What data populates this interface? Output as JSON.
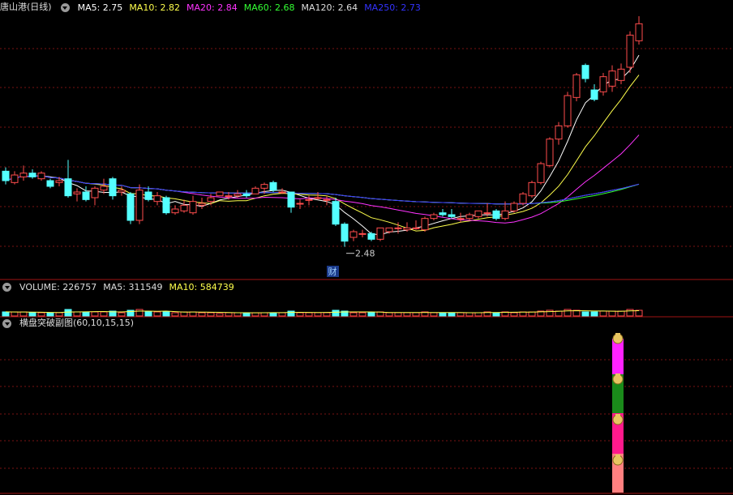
{
  "header": {
    "title": "唐山港(日线)",
    "ma": [
      {
        "label": "MA5: 2.75",
        "color": "#ffffff"
      },
      {
        "label": "MA10: 2.82",
        "color": "#ffff4c"
      },
      {
        "label": "MA20: 2.84",
        "color": "#ff33ff"
      },
      {
        "label": "MA60: 2.68",
        "color": "#33ff33"
      },
      {
        "label": "MA120: 2.64",
        "color": "#dddddd"
      },
      {
        "label": "MA250: 2.73",
        "color": "#3333ff"
      }
    ]
  },
  "volume_header": {
    "items": [
      {
        "label": "VOLUME: 226757",
        "color": "#dddddd"
      },
      {
        "label": "MA5: 311549",
        "color": "#dddddd"
      },
      {
        "label": "MA10: 584739",
        "color": "#ffff4c"
      }
    ]
  },
  "indicator_header": {
    "label": "横盘突破副图(60,10,15,15)",
    "color": "#dddddd"
  },
  "annotations": {
    "low_label": "2.48",
    "fin_marker": "财"
  },
  "colors": {
    "up": "#ff4d4d",
    "down": "#54ffff",
    "grid": "#7a1212",
    "sep": "#a01414"
  },
  "chart_data": {
    "type": "candlestick",
    "ylim": [
      2.35,
      3.7
    ],
    "candles": [
      {
        "o": 2.88,
        "c": 2.83,
        "h": 2.9,
        "l": 2.81
      },
      {
        "o": 2.82,
        "c": 2.86,
        "h": 2.88,
        "l": 2.81
      },
      {
        "o": 2.85,
        "c": 2.87,
        "h": 2.91,
        "l": 2.83
      },
      {
        "o": 2.87,
        "c": 2.85,
        "h": 2.89,
        "l": 2.84
      },
      {
        "o": 2.84,
        "c": 2.87,
        "h": 2.88,
        "l": 2.83
      },
      {
        "o": 2.83,
        "c": 2.8,
        "h": 2.84,
        "l": 2.79
      },
      {
        "o": 2.82,
        "c": 2.83,
        "h": 2.85,
        "l": 2.8
      },
      {
        "o": 2.84,
        "c": 2.75,
        "h": 2.94,
        "l": 2.74
      },
      {
        "o": 2.76,
        "c": 2.77,
        "h": 2.79,
        "l": 2.72
      },
      {
        "o": 2.77,
        "c": 2.73,
        "h": 2.8,
        "l": 2.72
      },
      {
        "o": 2.74,
        "c": 2.79,
        "h": 2.8,
        "l": 2.7
      },
      {
        "o": 2.78,
        "c": 2.8,
        "h": 2.84,
        "l": 2.76
      },
      {
        "o": 2.84,
        "c": 2.75,
        "h": 2.85,
        "l": 2.73
      },
      {
        "o": 2.77,
        "c": 2.78,
        "h": 2.8,
        "l": 2.75
      },
      {
        "o": 2.76,
        "c": 2.62,
        "h": 2.77,
        "l": 2.6
      },
      {
        "o": 2.62,
        "c": 2.78,
        "h": 2.81,
        "l": 2.6
      },
      {
        "o": 2.77,
        "c": 2.73,
        "h": 2.8,
        "l": 2.72
      },
      {
        "o": 2.72,
        "c": 2.75,
        "h": 2.77,
        "l": 2.7
      },
      {
        "o": 2.74,
        "c": 2.66,
        "h": 2.75,
        "l": 2.65
      },
      {
        "o": 2.66,
        "c": 2.68,
        "h": 2.7,
        "l": 2.65
      },
      {
        "o": 2.67,
        "c": 2.7,
        "h": 2.73,
        "l": 2.66
      },
      {
        "o": 2.66,
        "c": 2.72,
        "h": 2.75,
        "l": 2.65
      },
      {
        "o": 2.7,
        "c": 2.71,
        "h": 2.74,
        "l": 2.68
      },
      {
        "o": 2.72,
        "c": 2.74,
        "h": 2.76,
        "l": 2.7
      },
      {
        "o": 2.75,
        "c": 2.77,
        "h": 2.77,
        "l": 2.75
      },
      {
        "o": 2.75,
        "c": 2.75,
        "h": 2.77,
        "l": 2.73
      },
      {
        "o": 2.75,
        "c": 2.76,
        "h": 2.78,
        "l": 2.74
      },
      {
        "o": 2.76,
        "c": 2.75,
        "h": 2.78,
        "l": 2.74
      },
      {
        "o": 2.76,
        "c": 2.79,
        "h": 2.8,
        "l": 2.76
      },
      {
        "o": 2.79,
        "c": 2.81,
        "h": 2.82,
        "l": 2.76
      },
      {
        "o": 2.82,
        "c": 2.78,
        "h": 2.83,
        "l": 2.77
      },
      {
        "o": 2.77,
        "c": 2.77,
        "h": 2.79,
        "l": 2.76
      },
      {
        "o": 2.77,
        "c": 2.69,
        "h": 2.77,
        "l": 2.66
      },
      {
        "o": 2.71,
        "c": 2.71,
        "h": 2.73,
        "l": 2.68
      },
      {
        "o": 2.73,
        "c": 2.73,
        "h": 2.75,
        "l": 2.7
      },
      {
        "o": 2.74,
        "c": 2.74,
        "h": 2.77,
        "l": 2.73
      },
      {
        "o": 2.73,
        "c": 2.73,
        "h": 2.75,
        "l": 2.7
      },
      {
        "o": 2.72,
        "c": 2.6,
        "h": 2.74,
        "l": 2.59
      },
      {
        "o": 2.6,
        "c": 2.51,
        "h": 2.61,
        "l": 2.48
      },
      {
        "o": 2.53,
        "c": 2.56,
        "h": 2.57,
        "l": 2.51
      },
      {
        "o": 2.55,
        "c": 2.55,
        "h": 2.57,
        "l": 2.53
      },
      {
        "o": 2.55,
        "c": 2.52,
        "h": 2.56,
        "l": 2.51
      },
      {
        "o": 2.52,
        "c": 2.58,
        "h": 2.58,
        "l": 2.51
      },
      {
        "o": 2.56,
        "c": 2.58,
        "h": 2.58,
        "l": 2.55
      },
      {
        "o": 2.58,
        "c": 2.58,
        "h": 2.61,
        "l": 2.55
      },
      {
        "o": 2.57,
        "c": 2.58,
        "h": 2.61,
        "l": 2.56
      },
      {
        "o": 2.58,
        "c": 2.58,
        "h": 2.62,
        "l": 2.57
      },
      {
        "o": 2.57,
        "c": 2.63,
        "h": 2.64,
        "l": 2.56
      },
      {
        "o": 2.63,
        "c": 2.65,
        "h": 2.66,
        "l": 2.62
      },
      {
        "o": 2.66,
        "c": 2.65,
        "h": 2.68,
        "l": 2.64
      },
      {
        "o": 2.65,
        "c": 2.64,
        "h": 2.68,
        "l": 2.63
      },
      {
        "o": 2.63,
        "c": 2.63,
        "h": 2.66,
        "l": 2.61
      },
      {
        "o": 2.63,
        "c": 2.65,
        "h": 2.66,
        "l": 2.62
      },
      {
        "o": 2.64,
        "c": 2.67,
        "h": 2.67,
        "l": 2.63
      },
      {
        "o": 2.66,
        "c": 2.66,
        "h": 2.71,
        "l": 2.64
      },
      {
        "o": 2.67,
        "c": 2.63,
        "h": 2.68,
        "l": 2.62
      },
      {
        "o": 2.63,
        "c": 2.67,
        "h": 2.72,
        "l": 2.62
      },
      {
        "o": 2.67,
        "c": 2.71,
        "h": 2.72,
        "l": 2.66
      },
      {
        "o": 2.71,
        "c": 2.76,
        "h": 2.77,
        "l": 2.7
      },
      {
        "o": 2.75,
        "c": 2.82,
        "h": 2.83,
        "l": 2.74
      },
      {
        "o": 2.82,
        "c": 2.92,
        "h": 2.93,
        "l": 2.81
      },
      {
        "o": 2.91,
        "c": 3.05,
        "h": 3.06,
        "l": 2.9
      },
      {
        "o": 3.05,
        "c": 3.12,
        "h": 3.14,
        "l": 3.02
      },
      {
        "o": 3.12,
        "c": 3.28,
        "h": 3.3,
        "l": 3.11
      },
      {
        "o": 3.27,
        "c": 3.39,
        "h": 3.4,
        "l": 3.25
      },
      {
        "o": 3.44,
        "c": 3.37,
        "h": 3.45,
        "l": 3.35
      },
      {
        "o": 3.31,
        "c": 3.26,
        "h": 3.34,
        "l": 3.25
      },
      {
        "o": 3.3,
        "c": 3.38,
        "h": 3.4,
        "l": 3.28
      },
      {
        "o": 3.33,
        "c": 3.41,
        "h": 3.44,
        "l": 3.3
      },
      {
        "o": 3.36,
        "c": 3.42,
        "h": 3.45,
        "l": 3.34
      },
      {
        "o": 3.43,
        "c": 3.6,
        "h": 3.62,
        "l": 3.4
      },
      {
        "o": 3.57,
        "c": 3.66,
        "h": 3.7,
        "l": 3.55
      }
    ],
    "ma_current": {
      "MA5": 2.75,
      "MA10": 2.82,
      "MA20": 2.84,
      "MA60": 2.68,
      "MA120": 2.64,
      "MA250": 2.73
    },
    "volume": {
      "current": 226757,
      "ma5": 311549,
      "ma10": 584739
    }
  }
}
